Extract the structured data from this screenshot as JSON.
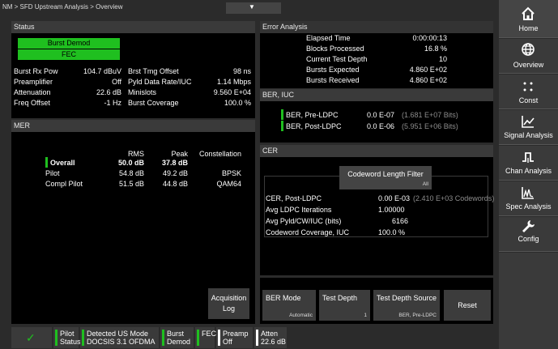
{
  "top_bar": {
    "breadcrumb": "NM > SFD Upstream Analysis > Overview",
    "dropdown_glyph": "▼"
  },
  "status_panel": {
    "title": "Status",
    "indicators": [
      "Burst Demod",
      "FEC"
    ],
    "rows": [
      [
        "Burst Rx Pow",
        "104.7 dBuV",
        "Brst Tmg Offset",
        "98 ns"
      ],
      [
        "Preamplifier",
        "Off",
        "Pyld Data Rate/IUC",
        "1.14 Mbps"
      ],
      [
        "Attenuation",
        "22.6 dB",
        "Minislots",
        "9.560 E+04"
      ],
      [
        "Freq Offset",
        "-1 Hz",
        "Burst Coverage",
        "100.0 %"
      ]
    ]
  },
  "mer_panel": {
    "title": "MER",
    "headers": [
      "RMS",
      "Peak",
      "Constellation"
    ],
    "rows": [
      {
        "label": "Overall",
        "rms": "50.0 dB",
        "peak": "37.8 dB",
        "constellation": ""
      },
      {
        "label": "Pilot",
        "rms": "54.8 dB",
        "peak": "49.2 dB",
        "constellation": "BPSK"
      },
      {
        "label": "Compl Pilot",
        "rms": "51.5 dB",
        "peak": "44.8 dB",
        "constellation": "QAM64"
      }
    ],
    "acquisition_button": [
      "Acquisition",
      "Log"
    ]
  },
  "error_panel": {
    "title": "Error Analysis",
    "rows": [
      [
        "Elapsed Time",
        "0:00:00:13"
      ],
      [
        "Blocks Processed",
        "16.8 %"
      ],
      [
        "Current Test Depth",
        "10"
      ],
      [
        "Bursts Expected",
        "4.860 E+02"
      ],
      [
        "Bursts Received",
        "4.860 E+02"
      ]
    ]
  },
  "ber_panel": {
    "title": "BER, IUC",
    "rows": [
      {
        "label": "BER, Pre-LDPC",
        "value": "0.0 E-07",
        "detail": "(1.681 E+07 Bits)"
      },
      {
        "label": "BER, Post-LDPC",
        "value": "0.0 E-06",
        "detail": "(5.951 E+06 Bits)"
      }
    ]
  },
  "cer_panel": {
    "title": "CER",
    "filter": {
      "label": "Codeword Length Filter",
      "value": "All"
    },
    "rows": [
      {
        "label": "CER, Post-LDPC",
        "value": "0.00 E-03",
        "detail": "(2.410 E+03 Codewords)"
      },
      {
        "label": "Avg LDPC Iterations",
        "value": "1.00000",
        "detail": ""
      },
      {
        "label": "Avg Pyld/CW/IUC (bits)",
        "value": "6166",
        "detail": ""
      },
      {
        "label": "Codeword Coverage, IUC",
        "value": "100.0 %",
        "detail": ""
      }
    ]
  },
  "bottom_buttons": [
    {
      "label": "BER Mode",
      "sub": "Automatic"
    },
    {
      "label": "Test Depth",
      "sub": "1"
    },
    {
      "label": "Test Depth Source",
      "sub": "BER, Pre-LDPC"
    },
    {
      "label": "Reset",
      "sub": ""
    }
  ],
  "sidebar": [
    {
      "label": "Home",
      "icon": "home-icon"
    },
    {
      "label": "Overview",
      "icon": "globe-icon"
    },
    {
      "label": "Const",
      "icon": "constellation-icon"
    },
    {
      "label": "Signal Analysis",
      "icon": "signal-analysis-icon"
    },
    {
      "label": "Chan Analysis",
      "icon": "channel-analysis-icon"
    },
    {
      "label": "Spec Analysis",
      "icon": "spectrum-analysis-icon"
    },
    {
      "label": "Config",
      "icon": "wrench-icon"
    }
  ],
  "status_bar": {
    "ok_glyph": "✓",
    "items": [
      {
        "lines": [
          "Pilot",
          "Status"
        ]
      },
      {
        "lines": [
          "Detected US Mode",
          "DOCSIS 3.1 OFDMA"
        ]
      },
      {
        "lines": [
          "Burst",
          "Demod"
        ]
      },
      {
        "lines": [
          "FEC",
          ""
        ]
      },
      {
        "lines": [
          "Preamp",
          "Off"
        ]
      },
      {
        "lines": [
          "Atten",
          "22.6 dB"
        ]
      }
    ]
  },
  "colors": {
    "accent_green": "#1fbf1f",
    "panel_bg": "#000000",
    "header_bg": "#3a3a3a",
    "sidebar_bg": "#3a3a3a"
  }
}
